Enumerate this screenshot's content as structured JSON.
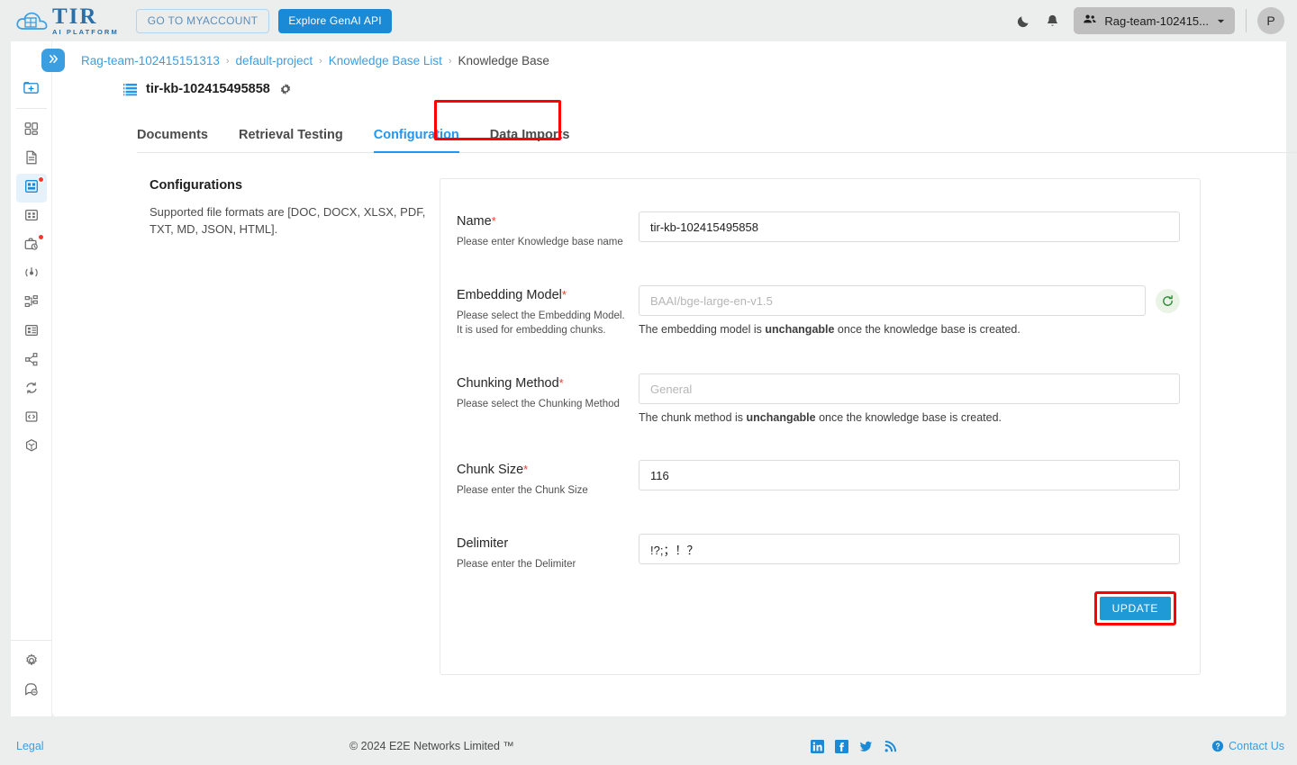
{
  "header": {
    "logo_title": "TIR",
    "logo_subtitle": "AI PLATFORM",
    "myaccount_label": "GO TO MYACCOUNT",
    "genai_label": "Explore GenAI API",
    "dark_mode_icon": "moon-icon",
    "notifications_icon": "bell-icon",
    "team_name": "Rag-team-102415...",
    "team_icon": "people-icon",
    "dropdown_icon": "chevron-down-icon",
    "avatar_initial": "P"
  },
  "sidebar": {
    "items": [
      {
        "icon": "folder-add-icon",
        "badge": false
      },
      {
        "icon": "dashboard-grid-icon",
        "badge": false
      },
      {
        "icon": "document-icon",
        "badge": false
      },
      {
        "icon": "knowledge-base-icon",
        "badge": true
      },
      {
        "icon": "grid-panel-icon",
        "badge": false
      },
      {
        "icon": "briefcase-clock-icon",
        "badge": true
      },
      {
        "icon": "target-node-icon",
        "badge": false
      },
      {
        "icon": "hierarchy-icon",
        "badge": false
      },
      {
        "icon": "table-panel-icon",
        "badge": false
      },
      {
        "icon": "share-nodes-icon",
        "badge": false
      },
      {
        "icon": "sync-refresh-icon",
        "badge": false
      },
      {
        "icon": "code-box-icon",
        "badge": false
      },
      {
        "icon": "cube-icon",
        "badge": false
      }
    ],
    "bottom_items": [
      {
        "icon": "gear-settings-icon"
      },
      {
        "icon": "support-chat-icon"
      }
    ]
  },
  "breadcrumb": {
    "collapse_icon": "double-chevron-right-icon",
    "items": [
      {
        "label": "Rag-team-102415151313",
        "link": true
      },
      {
        "label": "default-project",
        "link": true
      },
      {
        "label": "Knowledge Base List",
        "link": true
      },
      {
        "label": "Knowledge Base",
        "link": false
      }
    ],
    "separator": "›"
  },
  "page": {
    "kb_icon": "database-list-icon",
    "kb_title": "tir-kb-102415495858",
    "settings_icon": "gear-icon"
  },
  "tabs": [
    {
      "label": "Documents",
      "active": false
    },
    {
      "label": "Retrieval Testing",
      "active": false
    },
    {
      "label": "Configuration",
      "active": true
    },
    {
      "label": "Data Imports",
      "active": false
    }
  ],
  "left_panel": {
    "heading": "Configurations",
    "description": "Supported file formats are [DOC, DOCX, XLSX, PDF, TXT, MD, JSON, HTML]."
  },
  "form": {
    "fields": [
      {
        "label": "Name",
        "required": "*",
        "hint": "Please enter Knowledge base name",
        "value": "tir-kb-102415495858",
        "placeholder": "",
        "note_pre": "",
        "note_bold": "",
        "note_post": ""
      },
      {
        "label": "Embedding Model",
        "required": "*",
        "hint": "Please select the Embedding Model. It is used for embedding chunks.",
        "value": "",
        "placeholder": "BAAI/bge-large-en-v1.5",
        "note_pre": "The embedding model is ",
        "note_bold": "unchangable",
        "note_post": " once the knowledge base is created.",
        "refresh_icon": "refresh-icon"
      },
      {
        "label": "Chunking Method",
        "required": "*",
        "hint": "Please select the Chunking Method",
        "value": "",
        "placeholder": "General",
        "note_pre": "The chunk method is ",
        "note_bold": "unchangable",
        "note_post": " once the knowledge base is created."
      },
      {
        "label": "Chunk Size",
        "required": "*",
        "hint": "Please enter the Chunk Size",
        "value": "116",
        "placeholder": "",
        "note_pre": "",
        "note_bold": "",
        "note_post": ""
      },
      {
        "label": "Delimiter",
        "required": "",
        "hint": "Please enter the Delimiter",
        "value": "!?;；！？",
        "placeholder": "",
        "note_pre": "",
        "note_bold": "",
        "note_post": ""
      }
    ],
    "update_label": "UPDATE"
  },
  "footer": {
    "legal": "Legal",
    "copyright": "© 2024 E2E Networks Limited ™",
    "social": [
      {
        "icon": "linkedin-icon"
      },
      {
        "icon": "facebook-icon"
      },
      {
        "icon": "twitter-icon"
      },
      {
        "icon": "rss-icon"
      }
    ],
    "contact_icon": "question-circle-icon",
    "contact_label": "Contact Us"
  },
  "colors": {
    "accent_blue": "#1b8ad6",
    "tab_active": "#2196f3",
    "annotation_red": "#fe0000",
    "required_red": "#ef3b2d",
    "refresh_green": "#2e8b3a"
  }
}
